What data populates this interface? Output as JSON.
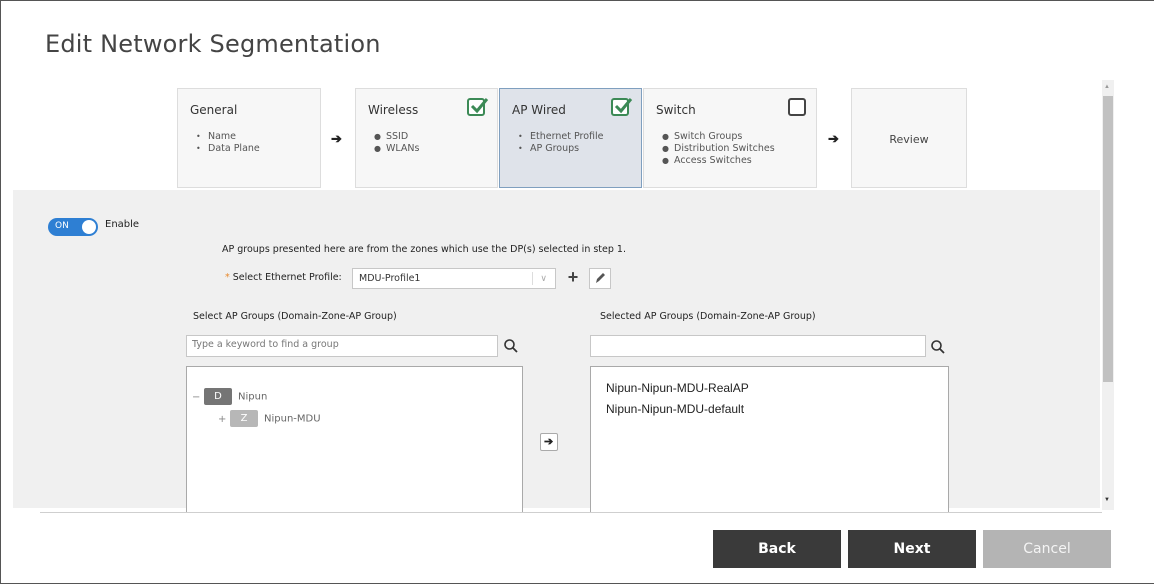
{
  "page": {
    "title": "Edit Network Segmentation"
  },
  "steps": [
    {
      "title": "General",
      "items": [
        "Name",
        "Data Plane"
      ],
      "check": "none"
    },
    {
      "title": "Wireless",
      "items": [
        "SSID",
        "WLANs"
      ],
      "check": "checked"
    },
    {
      "title": "AP Wired",
      "items": [
        "Ethernet Profile",
        "AP Groups"
      ],
      "check": "checked",
      "active": true
    },
    {
      "title": "Switch",
      "items": [
        "Switch Groups",
        "Distribution Switches",
        "Access Switches"
      ],
      "check": "unchecked"
    },
    {
      "title": "Review"
    }
  ],
  "toggle": {
    "state": "ON",
    "label": "Enable"
  },
  "info_text": "AP groups presented here are from the zones which use the DP(s) selected in step 1.",
  "ethernet_profile": {
    "label": "Select Ethernet Profile:",
    "required_mark": "*",
    "value": "MDU-Profile1"
  },
  "left_column": {
    "label": "Select AP Groups (Domain-Zone-AP Group)",
    "search_placeholder": "Type a keyword to find a group",
    "tree": [
      {
        "expander": "−",
        "badge": "D",
        "name": "Nipun"
      },
      {
        "expander": "+",
        "badge": "Z",
        "name": "Nipun-MDU"
      }
    ]
  },
  "right_column": {
    "label": "Selected AP Groups (Domain-Zone-AP Group)",
    "search_placeholder": "",
    "items": [
      "Nipun-Nipun-MDU-RealAP",
      "Nipun-Nipun-MDU-default"
    ]
  },
  "footer": {
    "back": "Back",
    "next": "Next",
    "cancel": "Cancel"
  },
  "colors": {
    "accent": "#2e7fd3",
    "check": "#3c8a56",
    "dark_button": "#3a3a3a",
    "cancel_button": "#b4b4b4"
  }
}
